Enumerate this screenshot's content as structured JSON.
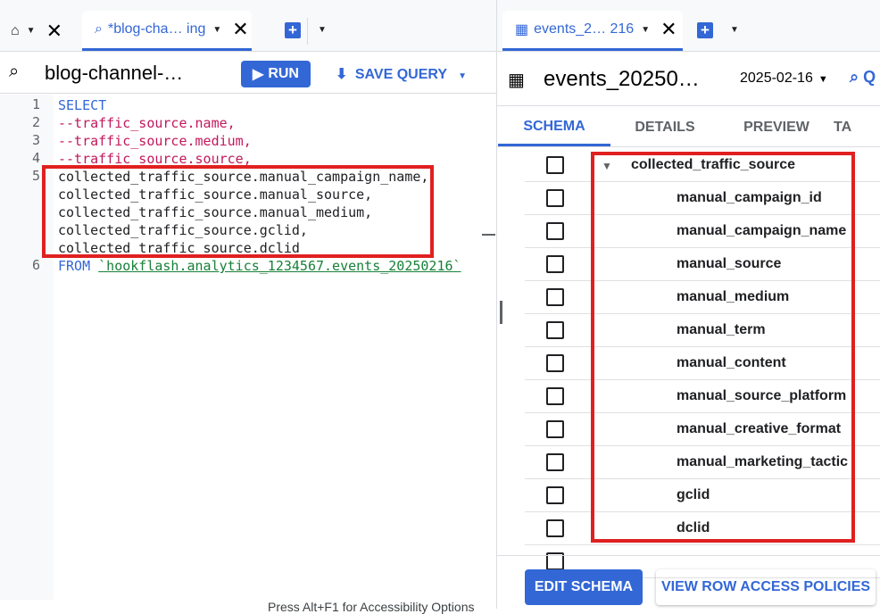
{
  "left_tabs": {
    "home_tab": "home",
    "query_tab": "*blog-cha… ing"
  },
  "query": {
    "title": "blog-channel-…",
    "run": "RUN",
    "save": "SAVE QUERY"
  },
  "editor": {
    "lines": [
      {
        "n": "1",
        "parts": [
          {
            "t": "SELECT",
            "c": "kw"
          }
        ]
      },
      {
        "n": "2",
        "parts": [
          {
            "t": "--traffic_source.name,",
            "c": "cm"
          }
        ]
      },
      {
        "n": "3",
        "parts": [
          {
            "t": "--traffic_source.medium,",
            "c": "cm"
          }
        ]
      },
      {
        "n": "4",
        "parts": [
          {
            "t": "--traffic_source.source,",
            "c": "cm"
          }
        ]
      },
      {
        "n": "5",
        "parts": [
          {
            "t": "collected_traffic_source.manual_campaign_name,",
            "c": "tx"
          }
        ]
      },
      {
        "n": "",
        "parts": [
          {
            "t": "collected_traffic_source.manual_source,",
            "c": "tx"
          }
        ]
      },
      {
        "n": "",
        "parts": [
          {
            "t": "collected_traffic_source.manual_medium,",
            "c": "tx"
          }
        ]
      },
      {
        "n": "",
        "parts": [
          {
            "t": "collected_traffic_source.gclid,",
            "c": "tx"
          }
        ]
      },
      {
        "n": "",
        "parts": [
          {
            "t": "collected_traffic_source.dclid",
            "c": "tx"
          }
        ]
      },
      {
        "n": "6",
        "parts": [
          {
            "t": "FROM ",
            "c": "kw"
          },
          {
            "t": "`hookflash.analytics_1234567.events_20250216`",
            "c": "str"
          }
        ]
      }
    ],
    "status": "Press Alt+F1 for Accessibility Options"
  },
  "right_tabs": {
    "table_tab": "events_2… 216"
  },
  "table": {
    "title": "events_20250…",
    "date": "2025-02-16",
    "query_label": "Q"
  },
  "schema_tabs": [
    "SCHEMA",
    "DETAILS",
    "PREVIEW",
    "TA"
  ],
  "schema": {
    "parent": "collected_traffic_source",
    "fields": [
      "manual_campaign_id",
      "manual_campaign_name",
      "manual_source",
      "manual_medium",
      "manual_term",
      "manual_content",
      "manual_source_platform",
      "manual_creative_format",
      "manual_marketing_tactic",
      "gclid",
      "dclid"
    ]
  },
  "buttons": {
    "edit": "EDIT SCHEMA",
    "policies": "VIEW ROW ACCESS POLICIES"
  },
  "colors": {
    "accent": "#3367d6",
    "highlight": "#e02020"
  }
}
